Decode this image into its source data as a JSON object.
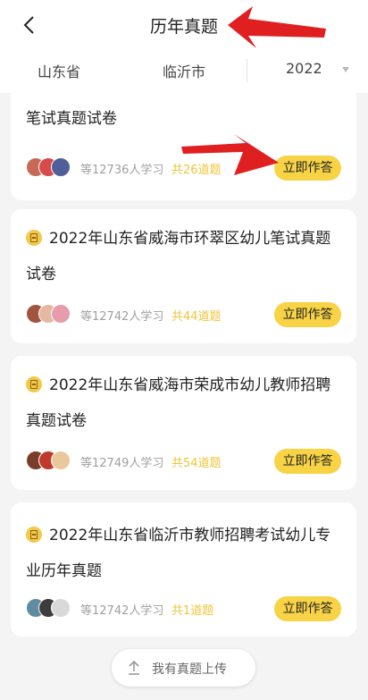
{
  "header": {
    "title": "历年真题",
    "back_icon": "chevron-left-icon"
  },
  "filters": {
    "province": "山东省",
    "city": "临沂市",
    "year": "2022"
  },
  "cards": [
    {
      "title": "笔试真题试卷",
      "learners": "等12736人学习",
      "count": "共26道题",
      "button": "立即作答",
      "avatar_colors": [
        "#c76a55",
        "#d94b4b",
        "#4f5f9a"
      ]
    },
    {
      "title": "2022年山东省威海市环翠区幼儿笔试真题试卷",
      "learners": "等12742人学习",
      "count": "共44道题",
      "button": "立即作答",
      "avatar_colors": [
        "#a0553d",
        "#e3b9a1",
        "#e69cab"
      ]
    },
    {
      "title": "2022年山东省威海市荣成市幼儿教师招聘真题试卷",
      "learners": "等12749人学习",
      "count": "共54道题",
      "button": "立即作答",
      "avatar_colors": [
        "#7a3d2c",
        "#c0392b",
        "#e9c99b"
      ]
    },
    {
      "title": "2022年山东省临沂市教师招聘考试幼儿专业历年真题",
      "learners": "等12742人学习",
      "count": "共1道题",
      "button": "立即作答",
      "avatar_colors": [
        "#5f8ca1",
        "#3d3d3d",
        "#d9d9d9"
      ]
    }
  ],
  "upload": {
    "label": "我有真题上传",
    "icon": "upload-arrow-icon"
  },
  "colors": {
    "accent": "#f7d345",
    "count_text": "#efc53a",
    "annotation_arrow": "#e02020"
  }
}
